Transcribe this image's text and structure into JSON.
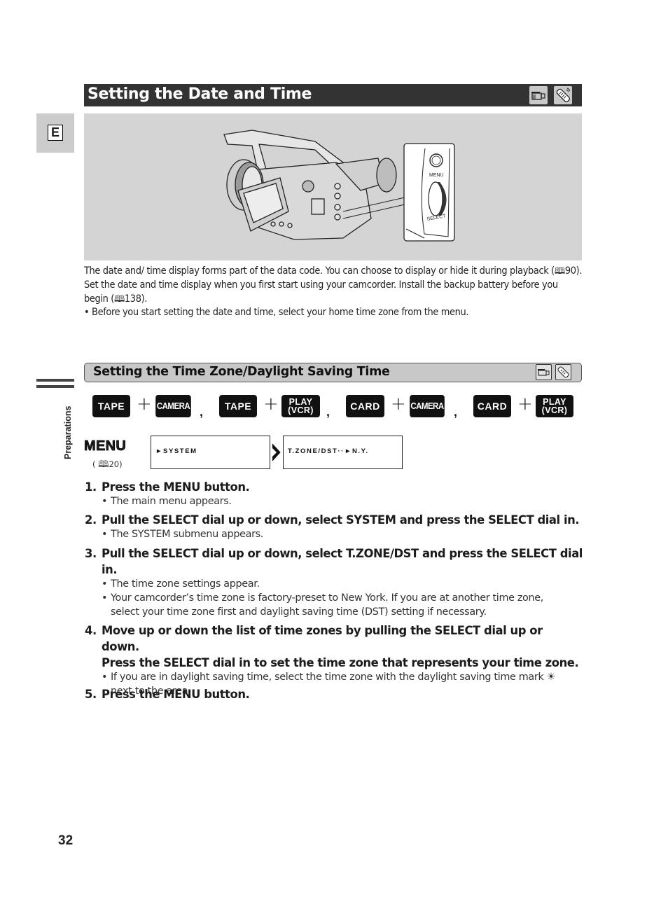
{
  "header": {
    "title": "Setting the Date and Time",
    "mode_icons": [
      "camcorder-icon",
      "remote-control-icon"
    ]
  },
  "language_tab": {
    "label": "E"
  },
  "side_tab": {
    "label": "Preparations"
  },
  "figure": {
    "callout_labels": {
      "menu": "MENU",
      "select": "SELECT"
    }
  },
  "intro": {
    "p1_text": "The date and/ time display forms part of the data code. You can choose to display or hide it during playback (",
    "p1_ref": "90",
    "p1_end": ").",
    "p2_text": "Set the date and time display when you first start using your camcorder. Install the backup battery before you begin (",
    "p2_ref": "138",
    "p2_end": ").",
    "bullet": "• Before you start setting the date and time, select your home time zone from the menu."
  },
  "subsection": {
    "title": "Setting the Time Zone/Daylight Saving Time",
    "mode_icons": [
      "camcorder-icon",
      "remote-control-icon"
    ]
  },
  "mode_combos": [
    {
      "left": "TAPE",
      "right": "CAMERA"
    },
    {
      "left": "TAPE",
      "right_line1": "PLAY",
      "right_line2": "(VCR)"
    },
    {
      "left": "CARD",
      "right": "CAMERA"
    },
    {
      "left": "CARD",
      "right_line1": "PLAY",
      "right_line2": "(VCR)"
    }
  ],
  "symbols": {
    "plus": "+",
    "comma": ","
  },
  "menu_row": {
    "label": "MENU",
    "ref_open": "( ",
    "ref_page": "20",
    "ref_close": ")",
    "lcd1": "►SYSTEM",
    "lcd2": "T.ZONE/DST··►N.Y."
  },
  "steps": [
    {
      "num": "1.",
      "head": "Press the MENU button.",
      "bullets": [
        "The main menu appears."
      ]
    },
    {
      "num": "2.",
      "head": "Pull the SELECT dial up or down, select SYSTEM and press the SELECT dial in.",
      "bullets": [
        "The SYSTEM submenu appears."
      ]
    },
    {
      "num": "3.",
      "head_line1": "Pull the SELECT dial up or down, select T.ZONE/DST and press the SELECT dial",
      "head_line2": "in.",
      "bullets": [
        "The time zone settings appear."
      ],
      "bullet2_line1": "Your camcorder’s time zone is factory-preset to New York. If you are at another time zone,",
      "bullet2_line2": "select your time zone first and daylight saving time (DST) setting if necessary."
    },
    {
      "num": "4.",
      "head_line1": "Move up or down the list of time zones by pulling the SELECT dial up or down.",
      "head_line2": "Press the SELECT dial in to set the time zone that represents your time zone.",
      "bullet_line1": "If you are in daylight saving time, select the time zone with the daylight saving time mark",
      "dst_mark": "☀",
      "bullet_line2": "next to the area."
    },
    {
      "num": "5.",
      "head": "Press the MENU button."
    }
  ],
  "bullet_char": "•",
  "page_number": "32"
}
